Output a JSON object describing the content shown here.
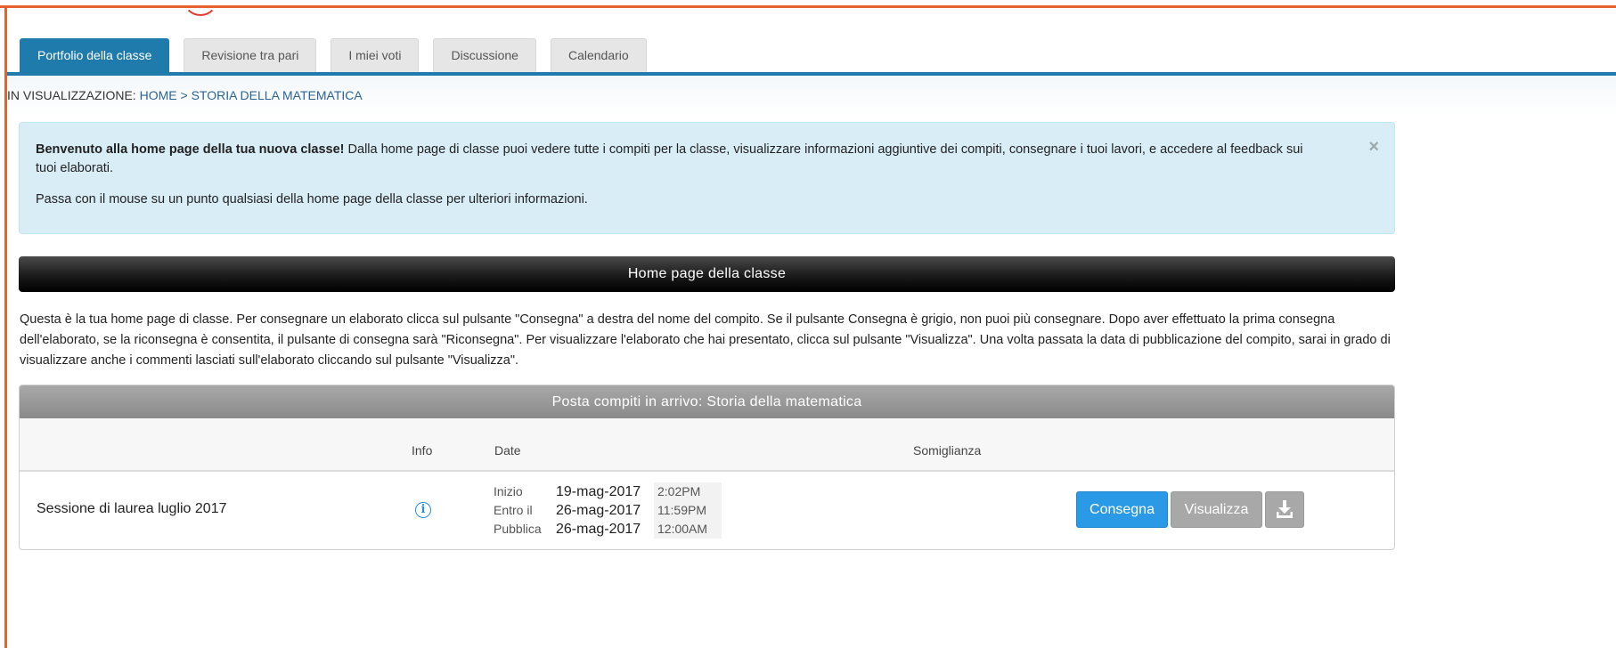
{
  "tabs": [
    {
      "label": "Portfolio della classe",
      "active": true
    },
    {
      "label": "Revisione tra pari",
      "active": false
    },
    {
      "label": "I miei voti",
      "active": false
    },
    {
      "label": "Discussione",
      "active": false
    },
    {
      "label": "Calendario",
      "active": false
    }
  ],
  "breadcrumb": {
    "prefix": "IN VISUALIZZAZIONE:",
    "home": "HOME",
    "separator": ">",
    "current": "STORIA DELLA MATEMATICA"
  },
  "alert": {
    "bold": "Benvenuto alla home page della tua nuova classe!",
    "text": " Dalla home page di classe puoi vedere tutte i compiti per la classe, visualizzare informazioni aggiuntive dei compiti, consegnare i tuoi lavori, e accedere al feedback sui tuoi elaborati.",
    "hint": "Passa con il mouse su un punto qualsiasi della home page della classe per ulteriori informazioni.",
    "close": "×"
  },
  "section_title": "Home page della classe",
  "intro": "Questa è la tua home page di classe. Per consegnare un elaborato clicca sul pulsante \"Consegna\" a destra del nome del compito. Se il pulsante Consegna è grigio, non puoi più consegnare. Dopo aver effettuato la prima consegna dell'elaborato, se la riconsegna è consentita, il pulsante di consegna sarà \"Riconsegna\". Per visualizzare l'elaborato che hai presentato, clicca sul pulsante \"Visualizza\". Una volta passata la data di pubblicazione del compito, sarai in grado di visualizzare anche i commenti lasciati sull'elaborato cliccando sul pulsante \"Visualizza\".",
  "inbox": {
    "title": "Posta compiti in arrivo: Storia della matematica",
    "columns": {
      "info": "Info",
      "date": "Date",
      "similarity": "Somiglianza"
    },
    "assignments": [
      {
        "title": "Sessione di laurea luglio 2017",
        "info_icon": "info-circle-icon",
        "dates": [
          {
            "label": "Inizio",
            "date": "19-mag-2017",
            "time": "2:02PM"
          },
          {
            "label": "Entro il",
            "date": "26-mag-2017",
            "time": "11:59PM"
          },
          {
            "label": "Pubblica",
            "date": "26-mag-2017",
            "time": "12:00AM"
          }
        ],
        "submit_label": "Consegna",
        "view_label": "Visualizza",
        "download_icon": "download-icon"
      }
    ]
  },
  "colors": {
    "accent": "#1e7bab",
    "frame": "#e8602c",
    "submit": "#2b9ae6",
    "disabled": "#a8a8a8"
  }
}
